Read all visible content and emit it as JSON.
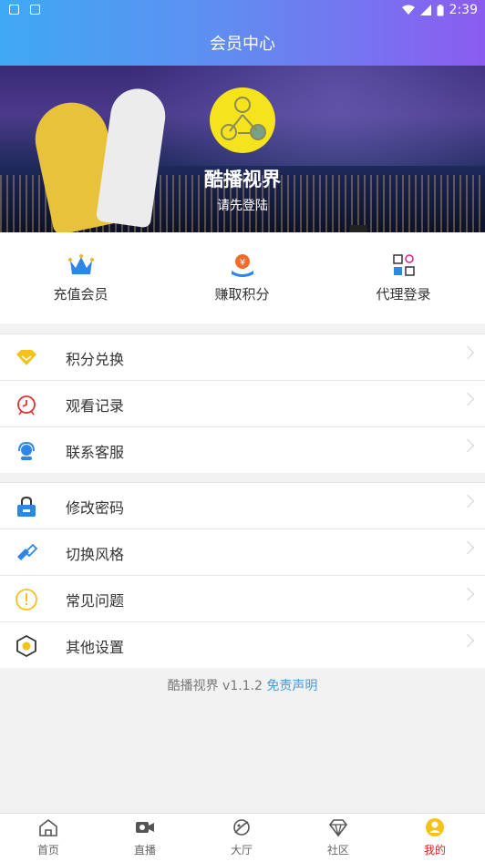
{
  "status_bar": {
    "time": "2:39"
  },
  "header": {
    "title": "会员中心"
  },
  "profile": {
    "brand_name": "酷播视界",
    "login_prompt": "请先登陆"
  },
  "quick_actions": [
    {
      "label": "充值会员",
      "icon": "crown-icon"
    },
    {
      "label": "赚取积分",
      "icon": "coin-hand-icon"
    },
    {
      "label": "代理登录",
      "icon": "agent-grid-icon"
    }
  ],
  "menu_group_1": [
    {
      "label": "积分兑换",
      "icon": "diamond-icon"
    },
    {
      "label": "观看记录",
      "icon": "clock-icon"
    },
    {
      "label": "联系客服",
      "icon": "headset-icon"
    }
  ],
  "menu_group_2": [
    {
      "label": "修改密码",
      "icon": "lock-icon"
    },
    {
      "label": "切换风格",
      "icon": "style-switch-icon"
    },
    {
      "label": "常见问题",
      "icon": "exclamation-icon"
    },
    {
      "label": "其他设置",
      "icon": "hexagon-settings-icon"
    }
  ],
  "footer": {
    "app_version": "酷播视界 v1.1.2",
    "disclaimer_link": "免责声明"
  },
  "tab_bar": [
    {
      "label": "首页",
      "icon": "home-icon"
    },
    {
      "label": "直播",
      "icon": "video-camera-icon"
    },
    {
      "label": "大厅",
      "icon": "planet-icon"
    },
    {
      "label": "社区",
      "icon": "gem-icon"
    },
    {
      "label": "我的",
      "icon": "user-circle-icon",
      "active": true
    }
  ],
  "colors": {
    "accent": "#e02020",
    "link": "#4a9be0",
    "header_start": "#3fa9f5",
    "header_end": "#8b5cf0",
    "logo": "#f5e31c"
  }
}
